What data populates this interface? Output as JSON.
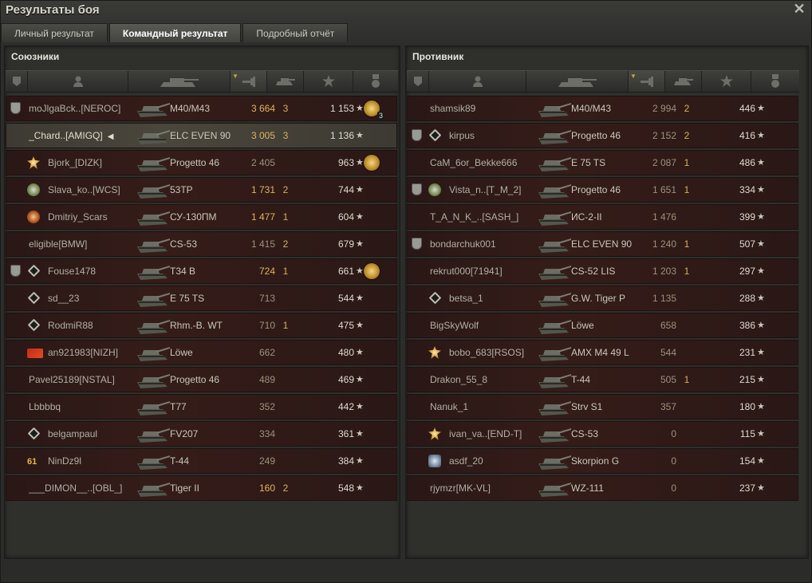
{
  "window": {
    "title": "Результаты боя"
  },
  "tabs": [
    {
      "label": "Личный результат",
      "active": false
    },
    {
      "label": "Командный результат",
      "active": true
    },
    {
      "label": "Подробный отчёт",
      "active": false
    }
  ],
  "allies": {
    "title": "Союзники",
    "rows": [
      {
        "platoon": true,
        "badge": "",
        "name": "moJlgaBck..[NEROC]",
        "tank": "M40/M43",
        "damage": "3 664",
        "damage_gold": true,
        "frags": "3",
        "xp": "1 153",
        "medal": true,
        "medal_count": "3",
        "self": false
      },
      {
        "platoon": false,
        "badge": "",
        "name": "_Chard..[AMIGQ]",
        "name_icon": "speaker-icon",
        "tank": "ELC EVEN 90",
        "damage": "3 005",
        "damage_gold": true,
        "frags": "3",
        "xp": "1 136",
        "medal": false,
        "self": true
      },
      {
        "platoon": false,
        "badge": "gold-star",
        "name": "Bjork_[DIZK]",
        "tank": "Progetto 46",
        "damage": "2 405",
        "damage_gold": false,
        "frags": "",
        "xp": "963",
        "medal": true,
        "medal_count": "",
        "self": false
      },
      {
        "platoon": false,
        "badge": "green",
        "name": "Slava_ko..[WCS]",
        "tank": "53TP",
        "damage": "1 731",
        "damage_gold": true,
        "frags": "2",
        "xp": "744",
        "medal": false,
        "self": false
      },
      {
        "platoon": false,
        "badge": "red",
        "name": "Dmitriy_Scars",
        "tank": "СУ-130ПМ",
        "damage": "1 477",
        "damage_gold": true,
        "frags": "1",
        "xp": "604",
        "medal": false,
        "self": false
      },
      {
        "platoon": false,
        "badge": "",
        "name": "eligible[BMW]",
        "tank": "CS-53",
        "damage": "1 415",
        "damage_gold": false,
        "frags": "2",
        "xp": "679",
        "medal": false,
        "self": false
      },
      {
        "platoon": true,
        "badge": "rank",
        "name": "Fouse1478",
        "tank": "T34 B",
        "damage": "724",
        "damage_gold": true,
        "frags": "1",
        "xp": "661",
        "medal": true,
        "medal_count": "",
        "self": false
      },
      {
        "platoon": false,
        "badge": "rank",
        "name": "sd__23",
        "tank": "E 75 TS",
        "damage": "713",
        "damage_gold": false,
        "frags": "",
        "xp": "544",
        "medal": false,
        "self": false
      },
      {
        "platoon": false,
        "badge": "rank",
        "name": "RodmiR88",
        "tank": "Rhm.-B. WT",
        "damage": "710",
        "damage_gold": false,
        "frags": "1",
        "xp": "475",
        "medal": false,
        "self": false
      },
      {
        "platoon": false,
        "badge": "flag",
        "name": "an921983[NIZH]",
        "tank": "Löwe",
        "damage": "662",
        "damage_gold": false,
        "frags": "",
        "xp": "480",
        "medal": false,
        "self": false
      },
      {
        "platoon": false,
        "badge": "",
        "name": "Pavel25189[NSTAL]",
        "tank": "Progetto 46",
        "damage": "489",
        "damage_gold": false,
        "frags": "",
        "xp": "469",
        "medal": false,
        "self": false
      },
      {
        "platoon": false,
        "badge": "",
        "name": "Lbbbbq",
        "tank": "T77",
        "damage": "352",
        "damage_gold": false,
        "frags": "",
        "xp": "442",
        "medal": false,
        "self": false
      },
      {
        "platoon": false,
        "badge": "rank",
        "name": "belgampaul",
        "tank": "FV207",
        "damage": "334",
        "damage_gold": false,
        "frags": "",
        "xp": "361",
        "medal": false,
        "self": false
      },
      {
        "platoon": false,
        "badge": "61",
        "name": "NinDz9l",
        "tank": "T-44",
        "damage": "249",
        "damage_gold": false,
        "frags": "",
        "xp": "384",
        "medal": false,
        "self": false
      },
      {
        "platoon": false,
        "badge": "",
        "name": "___DIMON__..[OBL_]",
        "tank": "Tiger II",
        "damage": "160",
        "damage_gold": true,
        "frags": "2",
        "xp": "548",
        "medal": false,
        "self": false
      }
    ]
  },
  "enemies": {
    "title": "Противник",
    "rows": [
      {
        "platoon": false,
        "badge": "",
        "name": "shamsik89",
        "tank": "M40/M43",
        "damage": "2 994",
        "damage_gold": false,
        "frags": "2",
        "xp": "446"
      },
      {
        "platoon": true,
        "badge": "rank",
        "name": "kirpus",
        "tank": "Progetto 46",
        "damage": "2 152",
        "damage_gold": false,
        "frags": "2",
        "xp": "416"
      },
      {
        "platoon": false,
        "badge": "",
        "name": "CaM_6or_Bekke666",
        "tank": "E 75 TS",
        "damage": "2 087",
        "damage_gold": false,
        "frags": "1",
        "xp": "486"
      },
      {
        "platoon": true,
        "badge": "green",
        "name": "Vista_n..[T_M_2]",
        "tank": "Progetto 46",
        "damage": "1 651",
        "damage_gold": false,
        "frags": "1",
        "xp": "334"
      },
      {
        "platoon": false,
        "badge": "",
        "name": "T_A_N_K_..[SASH_]",
        "tank": "ИС-2-II",
        "damage": "1 476",
        "damage_gold": false,
        "frags": "",
        "xp": "399"
      },
      {
        "platoon": true,
        "badge": "",
        "name": "bondarchuk001",
        "tank": "ELC EVEN 90",
        "damage": "1 240",
        "damage_gold": false,
        "frags": "1",
        "xp": "507"
      },
      {
        "platoon": false,
        "badge": "",
        "name": "rekrut000[71941]",
        "tank": "CS-52 LIS",
        "damage": "1 203",
        "damage_gold": false,
        "frags": "1",
        "xp": "297"
      },
      {
        "platoon": false,
        "badge": "rank",
        "name": "betsa_1",
        "tank": "G.W. Tiger P",
        "damage": "1 135",
        "damage_gold": false,
        "frags": "",
        "xp": "288"
      },
      {
        "platoon": false,
        "badge": "",
        "name": "BigSkyWolf",
        "tank": "Löwe",
        "damage": "658",
        "damage_gold": false,
        "frags": "",
        "xp": "386"
      },
      {
        "platoon": false,
        "badge": "gold-star",
        "name": "bobo_683[RSOS]",
        "tank": "AMX M4 49 L",
        "damage": "544",
        "damage_gold": false,
        "frags": "",
        "xp": "231"
      },
      {
        "platoon": false,
        "badge": "",
        "name": "Drakon_55_8",
        "tank": "T-44",
        "damage": "505",
        "damage_gold": false,
        "frags": "1",
        "xp": "215"
      },
      {
        "platoon": false,
        "badge": "",
        "name": "Nanuk_1",
        "tank": "Strv S1",
        "damage": "357",
        "damage_gold": false,
        "frags": "",
        "xp": "180"
      },
      {
        "platoon": false,
        "badge": "gold-star",
        "name": "ivan_va..[END-T]",
        "tank": "CS-53",
        "damage": "0",
        "damage_gold": false,
        "frags": "",
        "xp": "115"
      },
      {
        "platoon": false,
        "badge": "blue",
        "name": "asdf_20",
        "tank": "Skorpion G",
        "damage": "0",
        "damage_gold": false,
        "frags": "",
        "xp": "154"
      },
      {
        "platoon": false,
        "badge": "",
        "name": "rjymzr[MK-VL]",
        "tank": "WZ-111",
        "damage": "0",
        "damage_gold": false,
        "frags": "",
        "xp": "237"
      }
    ]
  },
  "icons": {
    "close": "close-icon",
    "columns": [
      "platoon-icon",
      "player-icon",
      "tank-icon",
      "damage-icon",
      "frags-icon",
      "xp-star-icon",
      "medal-icon"
    ]
  },
  "colors": {
    "gold_value": "#e0b45a",
    "row_bg": "#351c19",
    "self_row_bg": "#4a463c"
  }
}
